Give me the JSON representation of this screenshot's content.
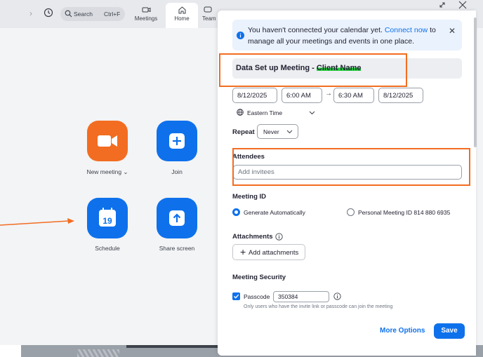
{
  "topbar": {
    "search_label": "Search",
    "search_shortcut": "Ctrl+F",
    "tabs": [
      {
        "label": "Meetings",
        "icon": "video-camera-icon"
      },
      {
        "label": "Home",
        "icon": "home-icon"
      },
      {
        "label": "Team",
        "icon": "chat-icon"
      }
    ]
  },
  "home": {
    "new_meeting": "New meeting",
    "join": "Join",
    "schedule": "Schedule",
    "schedule_day": "19",
    "share_screen": "Share screen"
  },
  "schedule_panel": {
    "notice_text": "You haven't connected your calendar yet.",
    "notice_link": "Connect now",
    "notice_tail": "to manage all your meetings and events in one place.",
    "title_prefix": "Data Set up Meeting -",
    "title_highlight": "Client Name",
    "start_date": "8/12/2025",
    "start_time": "6:00 AM",
    "end_time": "6:30 AM",
    "end_date": "8/12/2025",
    "arrow": "→",
    "timezone": "Eastern Time",
    "repeat_label": "Repeat",
    "repeat_value": "Never",
    "attendees_label": "Attendees",
    "attendees_placeholder": "Add invitees",
    "meeting_id_label": "Meeting ID",
    "meeting_id_auto": "Generate Automatically",
    "meeting_id_personal": "Personal Meeting ID 814 880 6935",
    "attachments_label": "Attachments",
    "add_attachments": "Add attachments",
    "security_label": "Meeting Security",
    "passcode_label": "Passcode",
    "passcode_value": "350384",
    "passcode_note": "Only users who have the invite link or passcode can join the meeting",
    "more_options": "More Options",
    "save": "Save"
  },
  "colors": {
    "accent": "#0e71eb",
    "new_meeting_tile": "#f26d21",
    "annotation": "#f26d21",
    "highlight": "#22d13c"
  }
}
